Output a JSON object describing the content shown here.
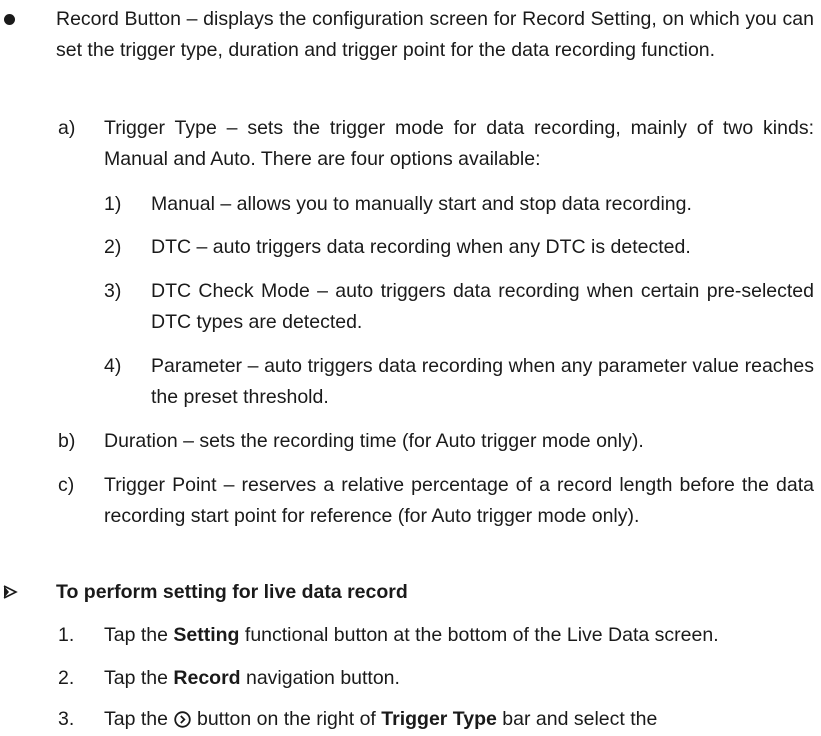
{
  "record_button": {
    "text": "Record Button – displays the configuration screen for Record Setting, on which you can set the trigger type, duration and trigger point for the data recording function."
  },
  "sub_items": [
    {
      "marker": "a)",
      "text": "Trigger Type – sets the trigger mode for data recording, mainly of two kinds: Manual and Auto. There are four options available:"
    },
    {
      "marker": "b)",
      "text": "Duration – sets the recording time (for Auto trigger mode only)."
    },
    {
      "marker": "c)",
      "text": "Trigger Point – reserves a relative percentage of a record length before the data recording start point for reference (for Auto trigger mode only)."
    }
  ],
  "trigger_options": [
    {
      "marker": "1)",
      "text": "Manual – allows you to manually start and stop data recording."
    },
    {
      "marker": "2)",
      "text": "DTC – auto triggers data recording when any DTC is detected."
    },
    {
      "marker": "3)",
      "text": "DTC Check Mode – auto triggers data recording when certain pre-selected DTC types are detected."
    },
    {
      "marker": "4)",
      "text": "Parameter – auto triggers data recording when any parameter value reaches the preset threshold."
    }
  ],
  "procedure": {
    "heading": "To perform setting for live data record",
    "steps": [
      {
        "marker": "1.",
        "pre": "Tap the ",
        "bold": "Setting",
        "post": " functional button at the bottom of the Live Data screen."
      },
      {
        "marker": "2.",
        "pre": "Tap the ",
        "bold": "Record",
        "post": " navigation button."
      },
      {
        "marker": "3.",
        "pre": "Tap the",
        "post_icon": "button on the right of ",
        "bold": "Trigger Type",
        "post": " bar and select the"
      }
    ]
  },
  "icons": {
    "bullet": "filled-circle-bullet",
    "heading_marker": "arrowhead-icon",
    "inline_button": "circle-chevron-right-icon"
  }
}
